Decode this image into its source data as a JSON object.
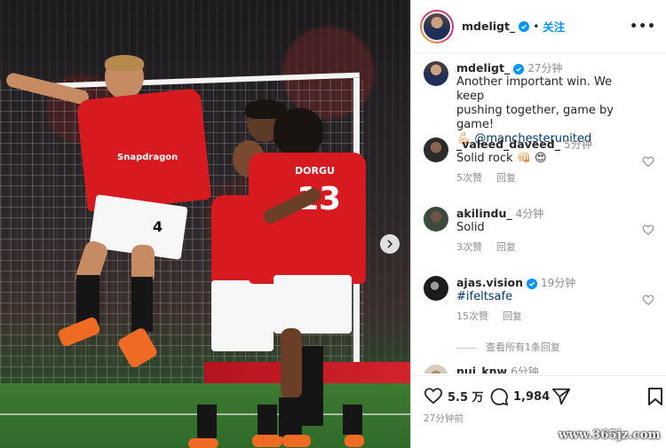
{
  "post": {
    "username": "mdeligt_",
    "follow_label": "关注",
    "separator": "•",
    "more_label": "•••",
    "caption_time": "27分钟",
    "caption_line1": "Another important win. We keep",
    "caption_line2": "pushing together, game by game!",
    "caption_emoji": "💪🏻",
    "caption_mention": "@manchesterunited",
    "shirt_number": "4",
    "shirt_sponsor": "Snapdragon",
    "shirt_name": "DORGU",
    "shirt_number_2": "13",
    "likes": "5.5 万",
    "comments_count": "1,984",
    "posted": "27分钟前",
    "brand_color": "#0095f6"
  },
  "comments": [
    {
      "user": "_valeed_daveed_",
      "time": "5分钟",
      "text": "Solid rock",
      "emoji": "👊🏻 😍",
      "likes": "5次赞",
      "reply": "回复"
    },
    {
      "user": "akilindu_",
      "time": "4分钟",
      "text": "Solid",
      "likes": "3次赞",
      "reply": "回复"
    },
    {
      "user": "ajas.vision",
      "time": "19分钟",
      "text": "#ifeltsafe",
      "likes": "15次赞",
      "reply": "回复"
    },
    {
      "user": "nui_knw",
      "time": "6分钟"
    }
  ],
  "view_replies": "查看所有1条回复",
  "watermark": "www.365jz.com"
}
